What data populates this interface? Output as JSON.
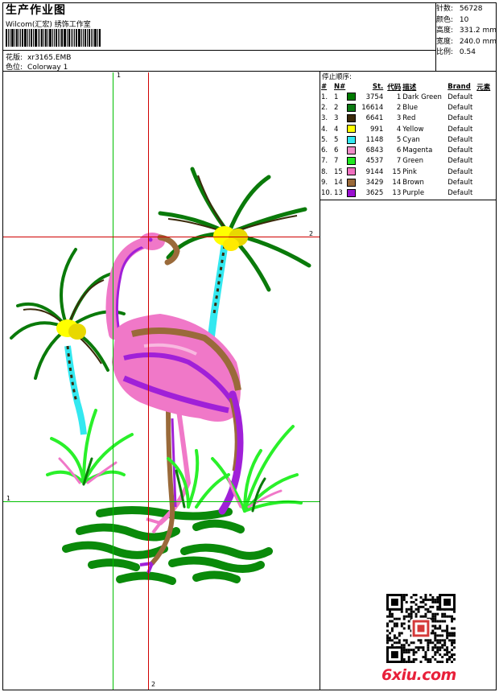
{
  "header": {
    "title": "生产作业图",
    "subtitle": "Wilcom(汇宏) 绣饰工作室",
    "pattern_label": "花版:",
    "pattern_value": "xr3165.EMB",
    "colorway_label": "色位:",
    "colorway_value": "Colorway 1"
  },
  "stats": [
    {
      "label": "针数:",
      "value": "56728"
    },
    {
      "label": "颜色:",
      "value": "10"
    },
    {
      "label": "高度:",
      "value": "331.2 mm"
    },
    {
      "label": "宽度:",
      "value": "240.0 mm"
    },
    {
      "label": "比例:",
      "value": "0.54"
    }
  ],
  "guides": {
    "v1": "1",
    "v2": "2",
    "h1": "1",
    "h2": "2"
  },
  "stop_table": {
    "title": "停止顺序:",
    "headers": {
      "no": "#",
      "n": "N#",
      "st": "St.",
      "code": "代码",
      "desc": "描述",
      "brand": "Brand",
      "element": "元素"
    },
    "rows": [
      {
        "no": "1.",
        "n": "1",
        "st": "3754",
        "code": "1",
        "desc": "Dark Green",
        "brand": "Default",
        "color": "#007a00"
      },
      {
        "no": "2.",
        "n": "2",
        "st": "16614",
        "code": "2",
        "desc": "Blue",
        "brand": "Default",
        "color": "#0b7a12"
      },
      {
        "no": "3.",
        "n": "3",
        "st": "6641",
        "code": "3",
        "desc": "Red",
        "brand": "Default",
        "color": "#3b2a0b"
      },
      {
        "no": "4.",
        "n": "4",
        "st": "991",
        "code": "4",
        "desc": "Yellow",
        "brand": "Default",
        "color": "#ffff00"
      },
      {
        "no": "5.",
        "n": "5",
        "st": "1148",
        "code": "5",
        "desc": "Cyan",
        "brand": "Default",
        "color": "#33e8f0"
      },
      {
        "no": "6.",
        "n": "6",
        "st": "6843",
        "code": "6",
        "desc": "Magenta",
        "brand": "Default",
        "color": "#f08cc8"
      },
      {
        "no": "7.",
        "n": "7",
        "st": "4537",
        "code": "7",
        "desc": "Green",
        "brand": "Default",
        "color": "#22e822"
      },
      {
        "no": "8.",
        "n": "15",
        "st": "9144",
        "code": "15",
        "desc": "Pink",
        "brand": "Default",
        "color": "#f070c0"
      },
      {
        "no": "9.",
        "n": "14",
        "st": "3429",
        "code": "14",
        "desc": "Brown",
        "brand": "Default",
        "color": "#9a6a3a"
      },
      {
        "no": "10.",
        "n": "13",
        "st": "3625",
        "code": "13",
        "desc": "Purple",
        "brand": "Default",
        "color": "#9a10d0"
      }
    ]
  },
  "logo_text": "6xiu.com",
  "colors": {
    "guide_green": "#00c000",
    "guide_red": "#d00000",
    "dark_green": "#0a7a0a",
    "light_green": "#2af02a",
    "pink": "#f078c8",
    "purple": "#a020d8",
    "brown": "#9a6a3a",
    "dark_brown": "#3b2a0b",
    "yellow": "#ffff00",
    "cyan": "#33e8f0"
  }
}
